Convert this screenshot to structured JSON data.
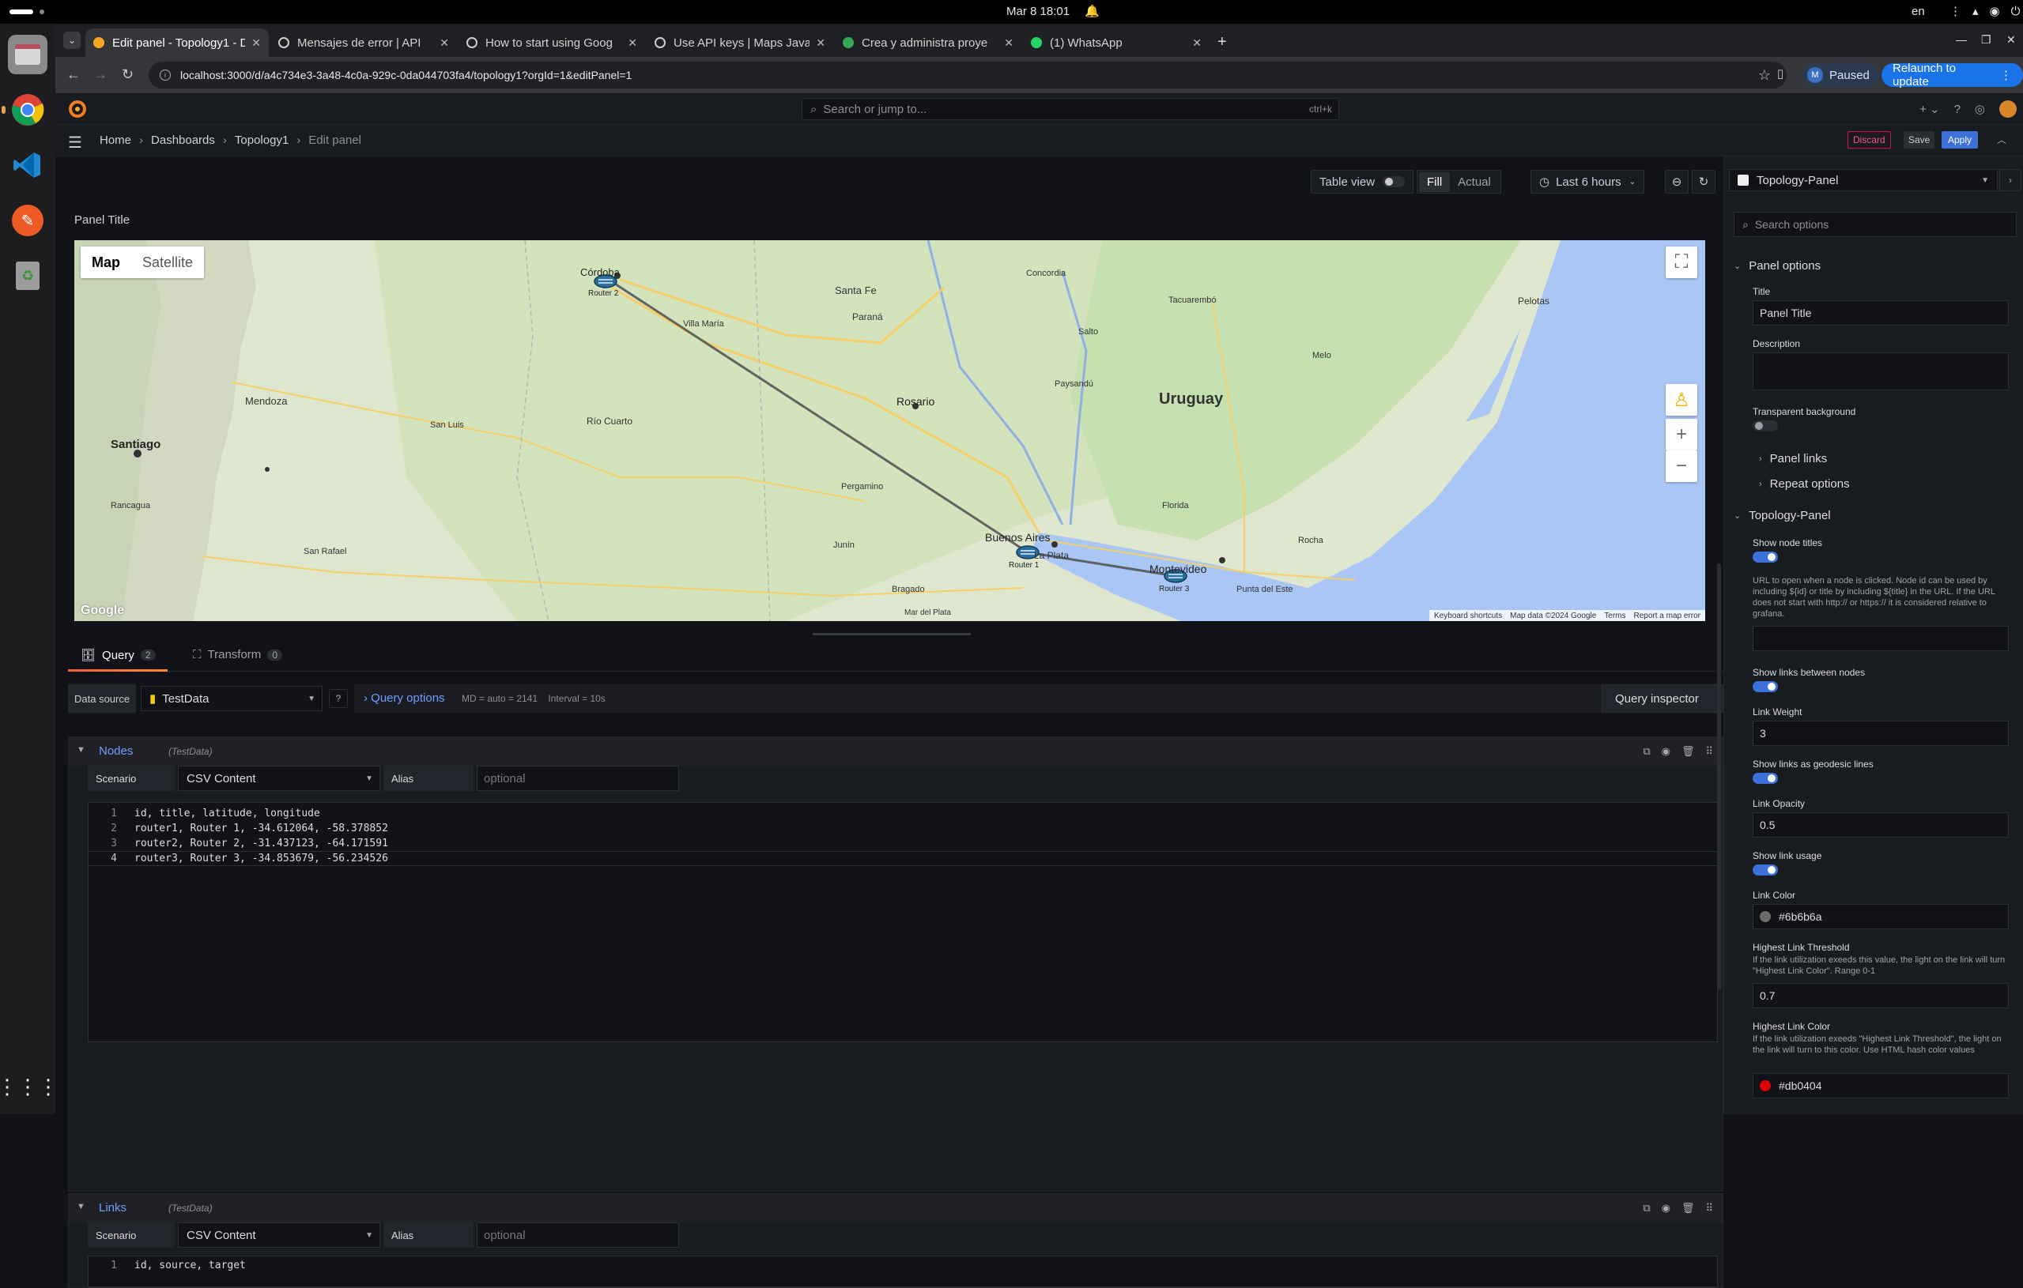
{
  "os": {
    "clock": "Mar 8  18:01",
    "language": "en"
  },
  "browser": {
    "tabs": [
      {
        "label": "Edit panel - Topology1 - D",
        "active": true,
        "color": "#f5a623"
      },
      {
        "label": "Mensajes de error | API",
        "active": false,
        "color": "#8ab4f8"
      },
      {
        "label": "How to start using Goog",
        "active": false,
        "color": "#8ab4f8"
      },
      {
        "label": "Use API keys | Maps Java",
        "active": false,
        "color": "#8ab4f8"
      },
      {
        "label": "Crea y administra proye",
        "active": false,
        "color": "#34a853"
      },
      {
        "label": "(1) WhatsApp",
        "active": false,
        "color": "#25d366"
      }
    ],
    "url": "localhost:3000/d/a4c734e3-3a48-4c0a-929c-0da044703fa4/topology1?orgId=1&editPanel=1",
    "profile_initial": "M",
    "profile_status": "Paused",
    "relaunch_label": "Relaunch to update"
  },
  "grafana": {
    "search_placeholder": "Search or jump to...",
    "search_shortcut": "ctrl+k",
    "breadcrumbs": [
      "Home",
      "Dashboards",
      "Topology1",
      "Edit panel"
    ],
    "discard_label": "Discard",
    "save_label": "Save",
    "apply_label": "Apply"
  },
  "toolbar": {
    "table_view_label": "Table view",
    "fill_label": "Fill",
    "actual_label": "Actual",
    "time_range": "Last 6 hours"
  },
  "panel": {
    "title": "Panel Title"
  },
  "map": {
    "map_tab": "Map",
    "satellite_tab": "Satellite",
    "google": "Google",
    "footer": [
      "Keyboard shortcuts",
      "Map data ©2024 Google",
      "Terms",
      "Report a map error"
    ],
    "places": [
      {
        "name": "Córdoba",
        "big": false
      },
      {
        "name": "Rosario",
        "big": false
      },
      {
        "name": "Uruguay",
        "big": true
      },
      {
        "name": "Buenos Aires",
        "big": false
      },
      {
        "name": "Montevideo",
        "big": false
      },
      {
        "name": "Santiago",
        "big": false
      },
      {
        "name": "Mendoza",
        "big": false
      },
      {
        "name": "Santa Fe",
        "big": false
      },
      {
        "name": "Paraná",
        "big": false
      },
      {
        "name": "Pelotas",
        "big": false
      },
      {
        "name": "Río Cuarto",
        "big": false
      },
      {
        "name": "Villa María",
        "big": false
      },
      {
        "name": "San Luis",
        "big": false
      },
      {
        "name": "La Plata",
        "big": false
      },
      {
        "name": "Mar del Plata",
        "big": false
      },
      {
        "name": "Punta del Este",
        "big": false
      },
      {
        "name": "Tacuarembó",
        "big": false
      },
      {
        "name": "Melo",
        "big": false
      },
      {
        "name": "Concordia",
        "big": false
      },
      {
        "name": "Rancagua",
        "big": false
      },
      {
        "name": "San Rafael",
        "big": false
      },
      {
        "name": "Pergamino",
        "big": false
      },
      {
        "name": "Junín",
        "big": false
      },
      {
        "name": "Bragado",
        "big": false
      },
      {
        "name": "Florida",
        "big": false
      },
      {
        "name": "Rocha",
        "big": false
      },
      {
        "name": "Paysandú",
        "big": false
      },
      {
        "name": "Salto",
        "big": false
      }
    ],
    "router_labels": [
      "Router 2",
      "Router 1",
      "Router 3"
    ]
  },
  "query": {
    "tabs": [
      {
        "label": "Query",
        "count": "2"
      },
      {
        "label": "Transform",
        "count": "0"
      }
    ],
    "data_source_label": "Data source",
    "data_source": "TestData",
    "query_options_label": "Query options",
    "md_meta": "MD = auto = 2141",
    "interval_meta": "Interval = 10s",
    "inspector_label": "Query inspector",
    "blocks": [
      {
        "name": "Nodes",
        "ds": "(TestData)",
        "scenario_label": "Scenario",
        "scenario": "CSV Content",
        "alias_label": "Alias",
        "alias_placeholder": "optional",
        "lines": [
          "id, title, latitude, longitude",
          "router1, Router 1, -34.612064, -58.378852",
          "router2, Router 2, -31.437123, -64.171591",
          "router3, Router 3, -34.853679, -56.234526"
        ]
      },
      {
        "name": "Links",
        "ds": "(TestData)",
        "scenario_label": "Scenario",
        "scenario": "CSV Content",
        "alias_label": "Alias",
        "alias_placeholder": "optional",
        "lines": [
          "id, source, target"
        ]
      }
    ]
  },
  "options": {
    "viz_name": "Topology-Panel",
    "search_placeholder": "Search options",
    "panel_options_label": "Panel options",
    "title_label": "Title",
    "title_value": "Panel Title",
    "description_label": "Description",
    "transparent_label": "Transparent background",
    "panel_links_label": "Panel links",
    "repeat_options_label": "Repeat options",
    "topology_section_label": "Topology-Panel",
    "show_node_titles_label": "Show node titles",
    "url_desc": "URL to open when a node is clicked. Node id can be used by including ${id} or title by including ${title} in the URL. If the URL does not start with http:// or https:// it is considered relative to grafana.",
    "show_links_label": "Show links between nodes",
    "link_weight_label": "Link Weight",
    "link_weight_value": "3",
    "geodesic_label": "Show links as geodesic lines",
    "link_opacity_label": "Link Opacity",
    "link_opacity_value": "0.5",
    "show_usage_label": "Show link usage",
    "link_color_label": "Link Color",
    "link_color_value": "#6b6b6a",
    "threshold_label": "Highest Link Threshold",
    "threshold_desc": "If the link utilization exeeds this value, the light on the link will turn \"Highest Link Color\". Range 0-1",
    "threshold_value": "0.7",
    "highest_color_label": "Highest Link Color",
    "highest_color_desc": "If the link utilization exeeds \"Highest Link Threshold\", the light on the link will turn to this color. Use HTML hash color values",
    "highest_color_value": "#db0404"
  }
}
